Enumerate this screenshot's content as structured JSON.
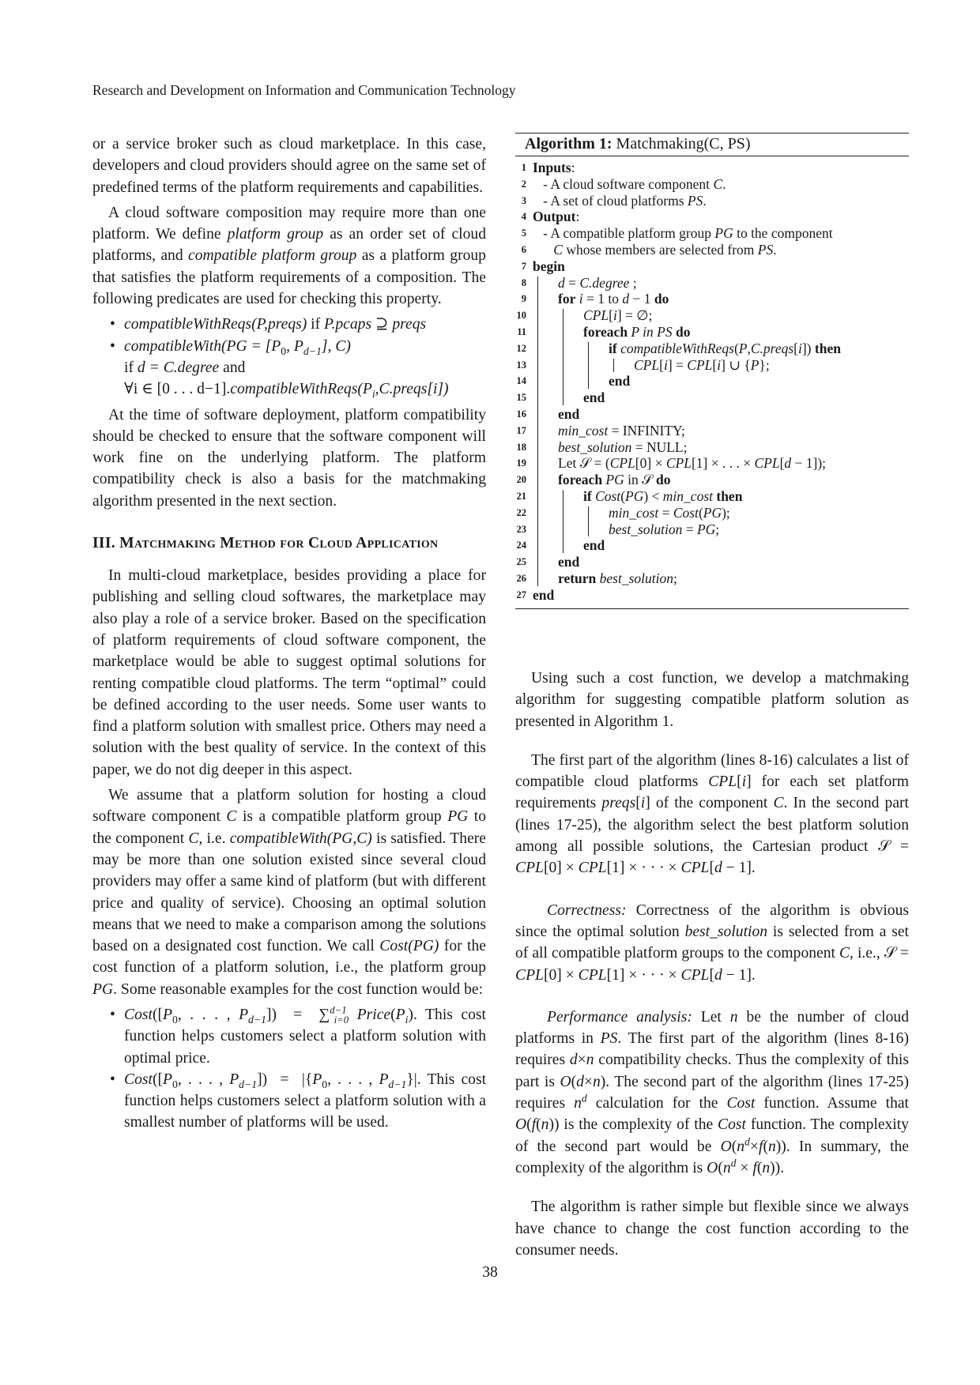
{
  "header": {
    "running_title": "Research and Development on Information and Communication Technology"
  },
  "left": {
    "p1": "or a service broker such as cloud marketplace. In this case, developers and cloud providers should agree on the same set of predefined terms of the platform requirements and capabilities.",
    "p2_a": "A cloud software composition may require more than one platform. We define ",
    "p2_term1": "platform group",
    "p2_b": " as an order set of cloud platforms, and ",
    "p2_term2": "compatible platform group",
    "p2_c": " as a platform group that satisfies the platform requirements of a composition. The following predicates are used for checking this property.",
    "pred1_a": "compatibleWithReqs(P,preqs)",
    "pred1_b": " if ",
    "pred1_c": "P.pcaps ⊇ preqs",
    "pred2_a": "compatibleWith(PG = [P",
    "pred2_sub0": "0",
    "pred2_b": ", P",
    "pred2_sub1": "d−1",
    "pred2_c": "], C)",
    "pred2_line2_a": "if ",
    "pred2_line2_b": "d = C.degree",
    "pred2_line2_c": " and",
    "pred2_line3_a": "∀i ∈ [0 . . . d−1].",
    "pred2_line3_b": "compatibleWithReqs(P",
    "pred2_line3_sub": "i",
    "pred2_line3_c": ",C.preqs[i])",
    "p3": "At the time of software deployment, platform compatibility should be checked to ensure that the software component will work fine on the underlying platform. The platform compatibility check is also a basis for the matchmaking algorithm presented in the next section.",
    "section_title": "III. Matchmaking Method for Cloud Application",
    "p4": "In multi-cloud marketplace, besides providing a place for publishing and selling cloud softwares, the marketplace may also play a role of a service broker. Based on the specification of platform requirements of cloud software component, the marketplace would be able to suggest optimal solutions for renting compatible cloud platforms. The term “optimal” could be defined according to the user needs. Some user wants to find a platform solution with smallest price. Others may need a solution with the best quality of service. In the context of this paper, we do not dig deeper in this aspect.",
    "p5_a": "We assume that a platform solution for hosting a cloud software component ",
    "p5_C1": "C",
    "p5_b": " is a compatible platform group ",
    "p5_PG1": "PG",
    "p5_c": " to the component ",
    "p5_C2": "C",
    "p5_d": ", i.e. ",
    "p5_fn": "compatibleWith(PG,C)",
    "p5_e": " is satisfied. There may be more than one solution existed since several cloud providers may offer a same kind of platform (but with different price and quality of service). Choosing an optimal solution means that we need to make a comparison among the solutions based on a designated cost function. We call ",
    "p5_cost": "Cost(PG)",
    "p5_f": " for the cost function of a platform solution, i.e., the platform group ",
    "p5_PG2": "PG",
    "p5_g": ". Some reasonable examples for the cost function would be:",
    "cost1_math": "Cost([P₀, . . . , P_{d−1}]) = Σ_{i=0}^{d−1} Price(P_i).",
    "cost1_text": " This cost function helps customers select a platform solution with optimal price.",
    "cost2_math": "Cost([P₀, . . . , P_{d−1}]) = |{P₀, . . . , P_{d−1}}|.",
    "cost2_text": " This cost function helps customers select a platform solution with a smallest number of platforms will be used."
  },
  "algorithm": {
    "label": "Algorithm 1:",
    "name": "Matchmaking(C, PS)",
    "lines": [
      {
        "n": "1",
        "html": "<b>Inputs</b>:"
      },
      {
        "n": "2",
        "html": "&nbsp;&nbsp;&nbsp;- A cloud software component <i>C</i>."
      },
      {
        "n": "3",
        "html": "&nbsp;&nbsp;&nbsp;- A set of cloud platforms <i>PS</i>."
      },
      {
        "n": "4",
        "html": "<b>Output</b>:"
      },
      {
        "n": "5",
        "html": "&nbsp;&nbsp;&nbsp;- A compatible platform group <i>PG</i> to the component"
      },
      {
        "n": "6",
        "html": "&nbsp;&nbsp;&nbsp;&nbsp;&nbsp;&nbsp;<i>C</i> whose members are selected from <i>PS</i>."
      },
      {
        "n": "7",
        "html": "<b>begin</b>"
      },
      {
        "n": "8",
        "indent": 1,
        "html": "<i>d</i> = <i>C.degree</i> ;"
      },
      {
        "n": "9",
        "indent": 1,
        "html": "<b>for</b> <i>i</i> = 1 to <i>d</i> − 1 <b>do</b>"
      },
      {
        "n": "10",
        "indent": 2,
        "html": "<i>CPL</i>[<i>i</i>] = ∅;"
      },
      {
        "n": "11",
        "indent": 2,
        "html": "<b>foreach</b> <i>P in PS</i> <b>do</b>"
      },
      {
        "n": "12",
        "indent": 3,
        "html": "<b>if</b> <i>compatibleWithReqs</i>(<i>P</i>,<i>C.preqs</i>[<i>i</i>]) <b>then</b>"
      },
      {
        "n": "13",
        "indent": 4,
        "html": "<i>CPL</i>[<i>i</i>] = <i>CPL</i>[<i>i</i>] ∪ {<i>P</i>};"
      },
      {
        "n": "14",
        "indent": 3,
        "html": "<b>end</b>"
      },
      {
        "n": "15",
        "indent": 2,
        "html": "<b>end</b>"
      },
      {
        "n": "16",
        "indent": 1,
        "html": "<b>end</b>"
      },
      {
        "n": "17",
        "indent": 1,
        "html": "<i>min_cost</i> = INFINITY;"
      },
      {
        "n": "18",
        "indent": 1,
        "html": "<i>best_solution</i> = NULL;"
      },
      {
        "n": "19",
        "indent": 1,
        "html": "Let 𝒮 = (<i>CPL</i>[0] × <i>CPL</i>[1] × . . . × <i>CPL</i>[<i>d</i> − 1]);"
      },
      {
        "n": "20",
        "indent": 1,
        "html": "<b>foreach</b> <i>PG</i> in 𝒮 <b>do</b>"
      },
      {
        "n": "21",
        "indent": 2,
        "html": "<b>if</b> <i>Cost</i>(<i>PG</i>) &lt; <i>min_cost</i> <b>then</b>"
      },
      {
        "n": "22",
        "indent": 3,
        "html": "<i>min_cost</i> = <i>Cost</i>(<i>PG</i>);"
      },
      {
        "n": "23",
        "indent": 3,
        "html": "<i>best_solution</i> = <i>PG</i>;"
      },
      {
        "n": "24",
        "indent": 2,
        "html": "<b>end</b>"
      },
      {
        "n": "25",
        "indent": 1,
        "html": "<b>end</b>"
      },
      {
        "n": "26",
        "indent": 1,
        "html": "<b>return</b> <i>best_solution</i>;"
      },
      {
        "n": "27",
        "html": "<b>end</b>"
      }
    ]
  },
  "right": {
    "p1": "Using such a cost function, we develop a matchmaking algorithm for suggesting compatible platform solution as presented in Algorithm 1.",
    "p2_html": "The first part of the algorithm (lines 8-16) calculates a list of compatible cloud platforms <i>CPL</i>[<i>i</i>] for each set platform requirements <i>preqs</i>[<i>i</i>] of the component <i>C</i>. In the second part (lines 17-25), the algorithm select the best platform solution among all possible solutions, the Cartesian product 𝒮 = <i>CPL</i>[0] × <i>CPL</i>[1] × · · · × <i>CPL</i>[<i>d</i> − 1].",
    "correctness_head": "Correctness:",
    "correctness_html": " Correctness of the algorithm is obvious since the optimal solution <i>best_solution</i> is selected from a set of all compatible platform groups to the component <i>C</i>, i.e., 𝒮 = <i>CPL</i>[0] × <i>CPL</i>[1] × · · · × <i>CPL</i>[<i>d</i> − 1].",
    "perf_head": "Performance analysis:",
    "perf_html": " Let <i>n</i> be the number of cloud platforms in <i>PS</i>. The first part of the algorithm (lines 8-16) requires <i>d</i>×<i>n</i> compatibility checks. Thus the complexity of this part is <i>O</i>(<i>d</i>×<i>n</i>). The second part of the algorithm (lines 17-25) requires <i>n<sup>d</sup></i> calculation for the <i>Cost</i> function. Assume that <i>O</i>(<i>f</i>(<i>n</i>)) is the complexity of the <i>Cost</i> function. The complexity of the second part would be <i>O</i>(<i>n<sup>d</sup></i>×<i>f</i>(<i>n</i>)). In summary, the complexity of the algorithm is <i>O</i>(<i>n<sup>d</sup></i> × <i>f</i>(<i>n</i>)).",
    "p_last": "The algorithm is rather simple but flexible since we always have chance to change the cost function according to the consumer needs."
  },
  "footer": {
    "page_number": "38"
  }
}
